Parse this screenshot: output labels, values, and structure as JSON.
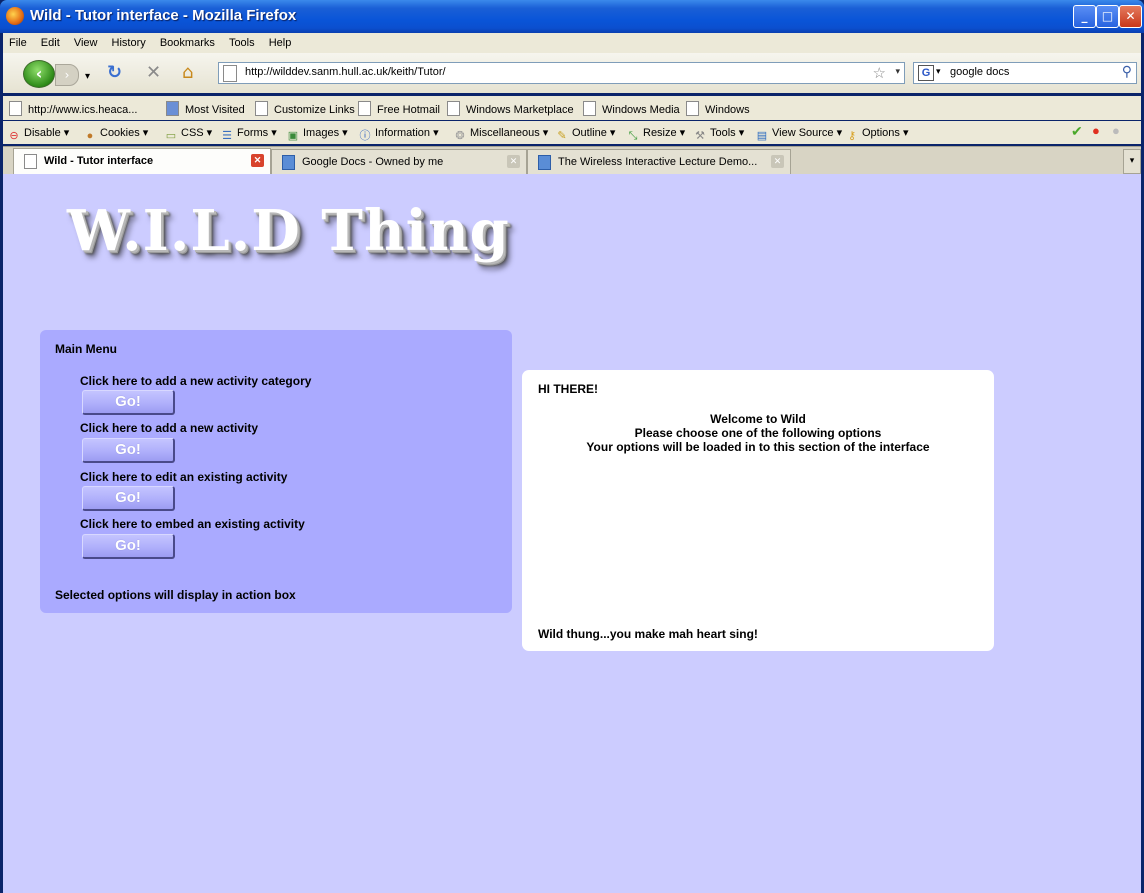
{
  "window": {
    "title": "Wild - Tutor interface - Mozilla Firefox"
  },
  "menubar": [
    "File",
    "Edit",
    "View",
    "History",
    "Bookmarks",
    "Tools",
    "Help"
  ],
  "navbar": {
    "url": "http://wilddev.sanm.hull.ac.uk/keith/Tutor/",
    "search_value": "google docs"
  },
  "bookmarks": [
    "http://www.ics.heaca...",
    "Most Visited",
    "Customize Links",
    "Free Hotmail",
    "Windows Marketplace",
    "Windows Media",
    "Windows"
  ],
  "devbar": [
    "Disable",
    "Cookies",
    "CSS",
    "Forms",
    "Images",
    "Information",
    "Miscellaneous",
    "Outline",
    "Resize",
    "Tools",
    "View Source",
    "Options"
  ],
  "tabs": [
    {
      "label": "Wild - Tutor interface"
    },
    {
      "label": "Google Docs - Owned by me"
    },
    {
      "label": "The Wireless Interactive Lecture Demo..."
    }
  ],
  "page": {
    "logo": "W.I.L.D Thing",
    "menu": {
      "title": "Main Menu",
      "items": [
        {
          "label": "Click here to add a new activity category",
          "button": "Go!"
        },
        {
          "label": "Click here to add a new activity",
          "button": "Go!"
        },
        {
          "label": "Click here to edit an existing activity",
          "button": "Go!"
        },
        {
          "label": "Click here to embed an existing activity",
          "button": "Go!"
        }
      ],
      "note": "Selected options will display in action box"
    },
    "action": {
      "greeting": "HI THERE!",
      "welcome_lines": [
        "Welcome to Wild",
        "Please choose one of the following options",
        "Your options will be loaded in to this section of the interface"
      ],
      "footer": "Wild thung...you make mah heart sing!"
    }
  },
  "colors": {
    "page_bg": "#ccccff",
    "menu_bg": "#aaaaff",
    "action_bg": "#ffffff"
  }
}
